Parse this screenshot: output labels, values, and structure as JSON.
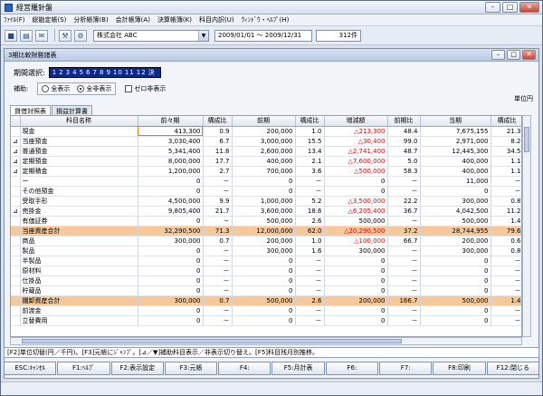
{
  "app_title": "経営羅針盤",
  "menu": [
    "ﾌｧｲﾙ(F)",
    "総勘定帳(S)",
    "分析帳簿(B)",
    "会計帳簿(A)",
    "決算帳簿(K)",
    "科目内訳(U)",
    "ｳｨﾝﾄﾞｳ・ﾍﾙﾌﾟ(H)"
  ],
  "toolbar": {
    "company": "株式会社 ABC",
    "period": "2009/01/01 ～ 2009/12/31",
    "count": "312件"
  },
  "child_title": "3期比較財務諸表",
  "period_select": {
    "label": "期間選択:",
    "months": [
      "1",
      "2",
      "3",
      "4",
      "5",
      "6",
      "7",
      "8",
      "9",
      "10",
      "11",
      "12",
      "決"
    ]
  },
  "aux": {
    "label": "補助:",
    "opt_all": "全表示",
    "opt_all2": "全非表示",
    "zero": "ゼロ非表示"
  },
  "unit": "単位円",
  "tabs": [
    "貸借対照表",
    "損益計算書"
  ],
  "columns": [
    "科目名称",
    "前々期",
    "構成比",
    "前期",
    "構成比",
    "増減額",
    "前期比",
    "当期",
    "構成比"
  ],
  "rows": [
    {
      "mark": "",
      "name": "現金",
      "a": "413,300",
      "ar": "0.9",
      "b": "200,000",
      "br": "1.0",
      "d": "△213,300",
      "neg": true,
      "p": "48.4",
      "c": "7,675,155",
      "cr": "21.3",
      "hl": false,
      "sel": true
    },
    {
      "mark": "⊿",
      "name": "当座預金",
      "a": "3,030,400",
      "ar": "6.7",
      "b": "3,000,000",
      "br": "15.5",
      "d": "△30,400",
      "neg": true,
      "p": "99.0",
      "c": "2,971,000",
      "cr": "8.2",
      "hl": false
    },
    {
      "mark": "⊿",
      "name": "普通預金",
      "a": "5,341,400",
      "ar": "11.8",
      "b": "2,600,000",
      "br": "13.4",
      "d": "△2,741,400",
      "neg": true,
      "p": "48.7",
      "c": "12,445,300",
      "cr": "34.5",
      "hl": false
    },
    {
      "mark": "⊿",
      "name": "定期預金",
      "a": "8,000,000",
      "ar": "17.7",
      "b": "400,000",
      "br": "2.1",
      "d": "△7,600,000",
      "neg": true,
      "p": "5.0",
      "c": "400,000",
      "cr": "1.1",
      "hl": false
    },
    {
      "mark": "⊿",
      "name": "定期積金",
      "a": "1,200,000",
      "ar": "2.7",
      "b": "700,000",
      "br": "3.6",
      "d": "△500,000",
      "neg": true,
      "p": "58.3",
      "c": "400,000",
      "cr": "1.1",
      "hl": false
    },
    {
      "mark": "",
      "name": "ー",
      "a": "0",
      "ar": "－",
      "b": "0",
      "br": "－",
      "d": "0",
      "neg": false,
      "p": "－",
      "c": "11,000",
      "cr": "－",
      "hl": false
    },
    {
      "mark": "",
      "name": "その他預金",
      "a": "0",
      "ar": "－",
      "b": "0",
      "br": "－",
      "d": "0",
      "neg": false,
      "p": "－",
      "c": "0",
      "cr": "－",
      "hl": false
    },
    {
      "mark": "",
      "name": "受取手形",
      "a": "4,500,000",
      "ar": "9.9",
      "b": "1,000,000",
      "br": "5.2",
      "d": "△3,500,000",
      "neg": true,
      "p": "22.2",
      "c": "300,000",
      "cr": "0.8",
      "hl": false
    },
    {
      "mark": "⊿",
      "name": "売掛金",
      "a": "9,805,400",
      "ar": "21.7",
      "b": "3,600,000",
      "br": "18.6",
      "d": "△6,205,400",
      "neg": true,
      "p": "36.7",
      "c": "4,042,500",
      "cr": "11.2",
      "hl": false
    },
    {
      "mark": "",
      "name": "有価証券",
      "a": "0",
      "ar": "－",
      "b": "500,000",
      "br": "2.6",
      "d": "500,000",
      "neg": false,
      "p": "－",
      "c": "500,000",
      "cr": "1.4",
      "hl": false
    },
    {
      "mark": "",
      "name": "当座資産合計",
      "a": "32,290,500",
      "ar": "71.3",
      "b": "12,000,000",
      "br": "62.0",
      "d": "△20,290,500",
      "neg": true,
      "p": "37.2",
      "c": "28,744,955",
      "cr": "79.6",
      "hl": true
    },
    {
      "mark": "",
      "name": "商品",
      "a": "300,000",
      "ar": "0.7",
      "b": "200,000",
      "br": "1.0",
      "d": "△100,000",
      "neg": true,
      "p": "66.7",
      "c": "200,000",
      "cr": "0.6",
      "hl": false
    },
    {
      "mark": "",
      "name": "製品",
      "a": "0",
      "ar": "－",
      "b": "300,000",
      "br": "1.6",
      "d": "300,000",
      "neg": false,
      "p": "－",
      "c": "300,000",
      "cr": "0.8",
      "hl": false
    },
    {
      "mark": "",
      "name": "半製品",
      "a": "0",
      "ar": "－",
      "b": "0",
      "br": "－",
      "d": "0",
      "neg": false,
      "p": "－",
      "c": "0",
      "cr": "－",
      "hl": false
    },
    {
      "mark": "",
      "name": "原材料",
      "a": "0",
      "ar": "－",
      "b": "0",
      "br": "－",
      "d": "0",
      "neg": false,
      "p": "－",
      "c": "0",
      "cr": "－",
      "hl": false
    },
    {
      "mark": "",
      "name": "仕掛品",
      "a": "0",
      "ar": "－",
      "b": "0",
      "br": "－",
      "d": "0",
      "neg": false,
      "p": "－",
      "c": "0",
      "cr": "－",
      "hl": false
    },
    {
      "mark": "",
      "name": "貯蔵品",
      "a": "0",
      "ar": "－",
      "b": "0",
      "br": "－",
      "d": "0",
      "neg": false,
      "p": "－",
      "c": "0",
      "cr": "－",
      "hl": false
    },
    {
      "mark": "",
      "name": "棚卸資産合計",
      "a": "300,000",
      "ar": "0.7",
      "b": "500,000",
      "br": "2.6",
      "d": "200,000",
      "neg": false,
      "p": "166.7",
      "c": "500,000",
      "cr": "1.4",
      "hl": true
    },
    {
      "mark": "",
      "name": "前渡金",
      "a": "0",
      "ar": "－",
      "b": "0",
      "br": "－",
      "d": "0",
      "neg": false,
      "p": "－",
      "c": "0",
      "cr": "－",
      "hl": false
    },
    {
      "mark": "",
      "name": "立替費用",
      "a": "0",
      "ar": "－",
      "b": "0",
      "br": "－",
      "d": "0",
      "neg": false,
      "p": "－",
      "c": "0",
      "cr": "－",
      "hl": false
    }
  ],
  "hint": "[F2]単位切替(円／千円)。[F3]元帳にｼﾞｬﾝﾌﾟ。[⊿／▼]補助科目表示／非表示切り替え。[F5]科目残月別推移。",
  "fkeys": [
    "ESC:ｷｬﾝｾﾙ",
    "F1:ﾍﾙﾌﾟ",
    "F2:表示設定",
    "F3:元帳",
    "F4:",
    "F5:月計表",
    "F6:",
    "F7:",
    "F8:印刷",
    "F12:閉じる"
  ]
}
